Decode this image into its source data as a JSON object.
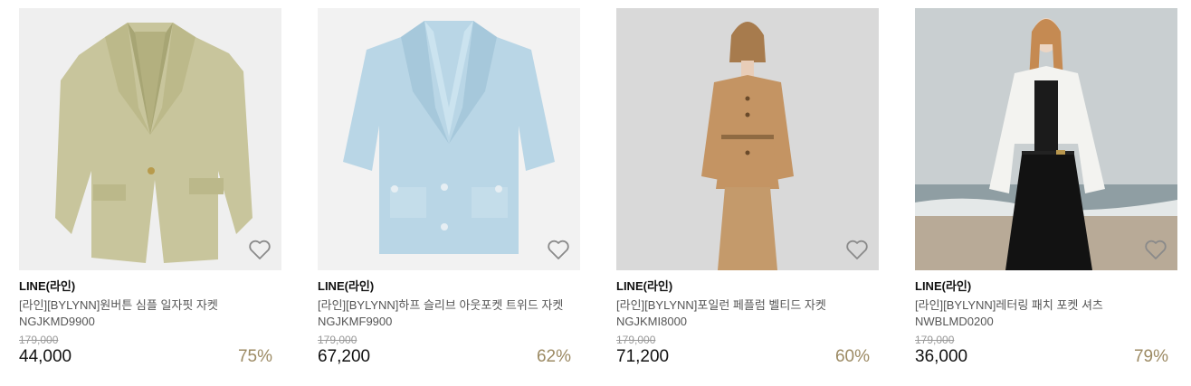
{
  "products": [
    {
      "brand": "LINE(라인)",
      "name": "[라인][BYLYNN]원버튼 심플 일자핏 자켓 NGJKMD9900",
      "original_price": "179,000",
      "price": "44,000",
      "discount": "75%",
      "wishlist_icon": "heart-outline-icon"
    },
    {
      "brand": "LINE(라인)",
      "name": "[라인][BYLYNN]하프 슬리브 아웃포켓 트위드 자켓 NGJKMF9900",
      "original_price": "179,000",
      "price": "67,200",
      "discount": "62%",
      "wishlist_icon": "heart-outline-icon"
    },
    {
      "brand": "LINE(라인)",
      "name": "[라인][BYLYNN]포일런 페플럼 벨티드 자켓 NGJKMI8000",
      "original_price": "179,000",
      "price": "71,200",
      "discount": "60%",
      "wishlist_icon": "heart-outline-icon"
    },
    {
      "brand": "LINE(라인)",
      "name": "[라인][BYLYNN]레터링 패치 포켓 셔츠 NWBLMD0200",
      "original_price": "179,000",
      "price": "36,000",
      "discount": "79%",
      "wishlist_icon": "heart-outline-icon"
    }
  ],
  "colors": {
    "discount": "#9c8a63",
    "original_price": "#999999",
    "heart_outline": "#8a8a8a"
  }
}
